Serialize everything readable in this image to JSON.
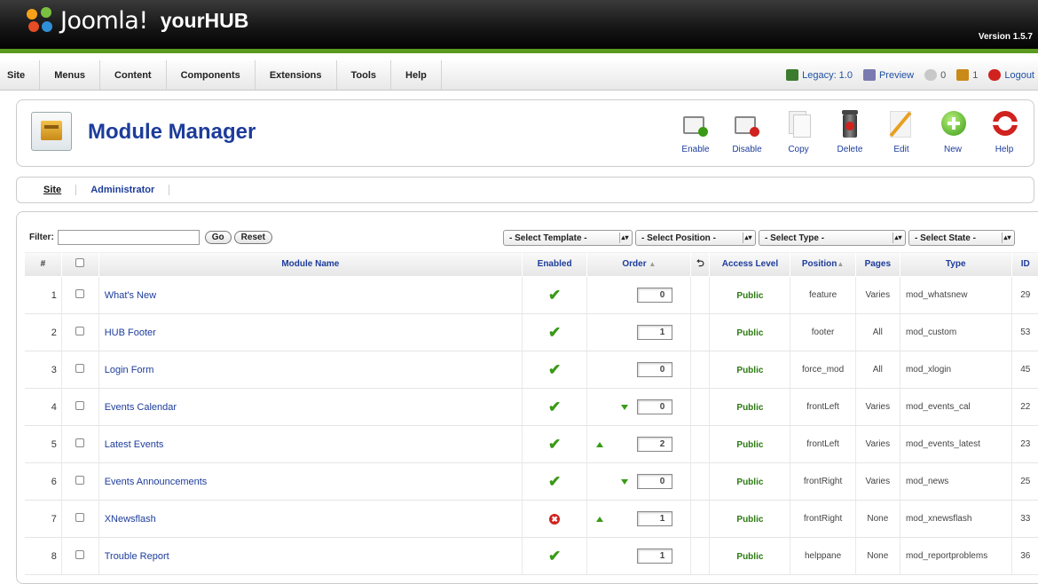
{
  "header": {
    "logo_text": "Joomla!",
    "site_name": "yourHUB",
    "version": "Version 1.5.7"
  },
  "menu": [
    "Site",
    "Menus",
    "Content",
    "Components",
    "Extensions",
    "Tools",
    "Help"
  ],
  "status": {
    "legacy": "Legacy: 1.0",
    "preview": "Preview",
    "messages": "0",
    "users": "1",
    "logout": "Logout"
  },
  "page": {
    "title": "Module Manager"
  },
  "toolbar": {
    "enable": "Enable",
    "disable": "Disable",
    "copy": "Copy",
    "delete": "Delete",
    "edit": "Edit",
    "new": "New",
    "help": "Help"
  },
  "tabs": {
    "site": "Site",
    "administrator": "Administrator"
  },
  "filter": {
    "label": "Filter:",
    "value": "",
    "go": "Go",
    "reset": "Reset",
    "template": "- Select Template -",
    "position": "- Select Position -",
    "type": "- Select Type -",
    "state": "- Select State -"
  },
  "table": {
    "headers": {
      "num": "#",
      "name": "Module Name",
      "enabled": "Enabled",
      "order": "Order",
      "access": "Access Level",
      "position": "Position",
      "pages": "Pages",
      "type": "Type",
      "id": "ID"
    },
    "rows": [
      {
        "n": "1",
        "name": "What's New",
        "enabled": true,
        "up": false,
        "down": false,
        "order": "0",
        "access": "Public",
        "position": "feature",
        "pages": "Varies",
        "type": "mod_whatsnew",
        "id": "29"
      },
      {
        "n": "2",
        "name": "HUB Footer",
        "enabled": true,
        "up": false,
        "down": false,
        "order": "1",
        "access": "Public",
        "position": "footer",
        "pages": "All",
        "type": "mod_custom",
        "id": "53"
      },
      {
        "n": "3",
        "name": "Login Form",
        "enabled": true,
        "up": false,
        "down": false,
        "order": "0",
        "access": "Public",
        "position": "force_mod",
        "pages": "All",
        "type": "mod_xlogin",
        "id": "45"
      },
      {
        "n": "4",
        "name": "Events Calendar",
        "enabled": true,
        "up": false,
        "down": true,
        "order": "0",
        "access": "Public",
        "position": "frontLeft",
        "pages": "Varies",
        "type": "mod_events_cal",
        "id": "22"
      },
      {
        "n": "5",
        "name": "Latest Events",
        "enabled": true,
        "up": true,
        "down": false,
        "order": "2",
        "access": "Public",
        "position": "frontLeft",
        "pages": "Varies",
        "type": "mod_events_latest",
        "id": "23"
      },
      {
        "n": "6",
        "name": "Events Announcements",
        "enabled": true,
        "up": false,
        "down": true,
        "order": "0",
        "access": "Public",
        "position": "frontRight",
        "pages": "Varies",
        "type": "mod_news",
        "id": "25"
      },
      {
        "n": "7",
        "name": "XNewsflash",
        "enabled": false,
        "up": true,
        "down": false,
        "order": "1",
        "access": "Public",
        "position": "frontRight",
        "pages": "None",
        "type": "mod_xnewsflash",
        "id": "33"
      },
      {
        "n": "8",
        "name": "Trouble Report",
        "enabled": true,
        "up": false,
        "down": false,
        "order": "1",
        "access": "Public",
        "position": "helppane",
        "pages": "None",
        "type": "mod_reportproblems",
        "id": "36"
      }
    ]
  }
}
